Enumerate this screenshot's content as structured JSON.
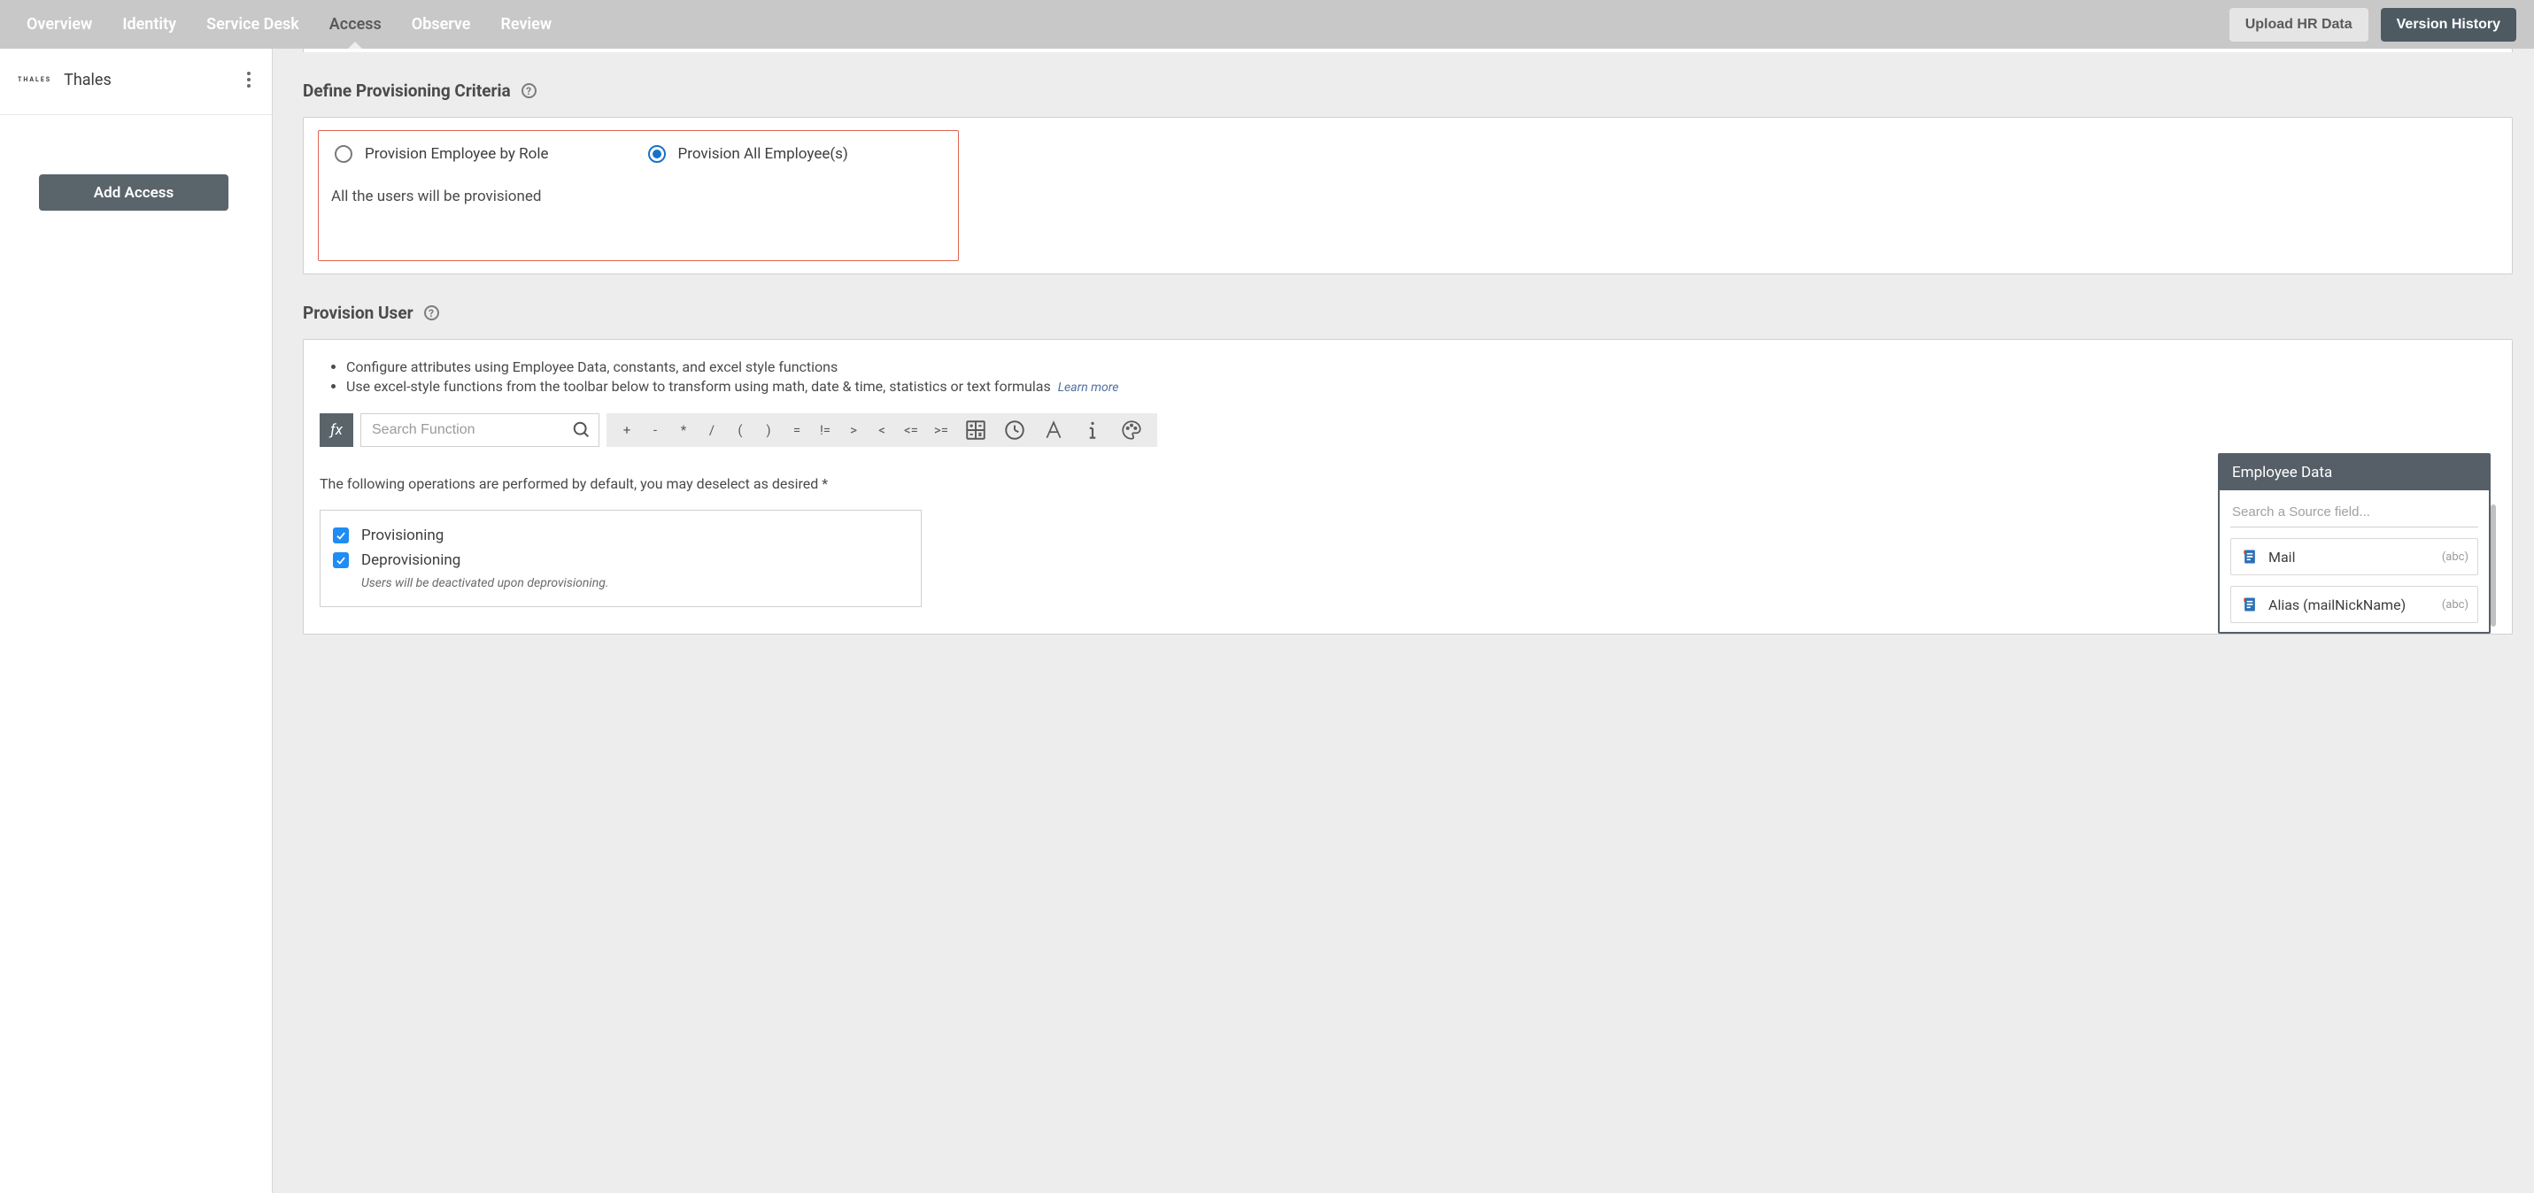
{
  "nav": {
    "tabs": [
      "Overview",
      "Identity",
      "Service Desk",
      "Access",
      "Observe",
      "Review"
    ],
    "active": "Access",
    "upload": "Upload HR Data",
    "history": "Version History"
  },
  "sidebar": {
    "company_logo": "THALES",
    "company_name": "Thales",
    "add_access": "Add Access"
  },
  "criteria": {
    "title": "Define Provisioning Criteria",
    "radio_role": "Provision Employee by Role",
    "radio_all": "Provision All Employee(s)",
    "desc": "All the users will be provisioned"
  },
  "provision": {
    "title": "Provision User",
    "bullet1": "Configure attributes using Employee Data, constants, and excel style functions",
    "bullet2": "Use excel-style functions from the toolbar below to transform using math, date & time, statistics or text formulas",
    "learn_more": "Learn more",
    "fx": "ƒx",
    "search_placeholder": "Search Function",
    "ops": [
      "+",
      "-",
      "*",
      "/",
      "(",
      ")",
      "=",
      "!=",
      ">",
      "<",
      "<=",
      ">="
    ],
    "ops_note": "The following operations are performed by default, you may deselect as desired *",
    "chk_prov": "Provisioning",
    "chk_deprov": "Deprovisioning",
    "chk_deprov_sub": "Users will be deactivated upon deprovisioning."
  },
  "emp": {
    "header": "Employee Data",
    "search_placeholder": "Search a Source field...",
    "field1_name": "Mail",
    "field1_type": "(abc)",
    "field2_name": "Alias (mailNickName)",
    "field2_type": "(abc)"
  }
}
